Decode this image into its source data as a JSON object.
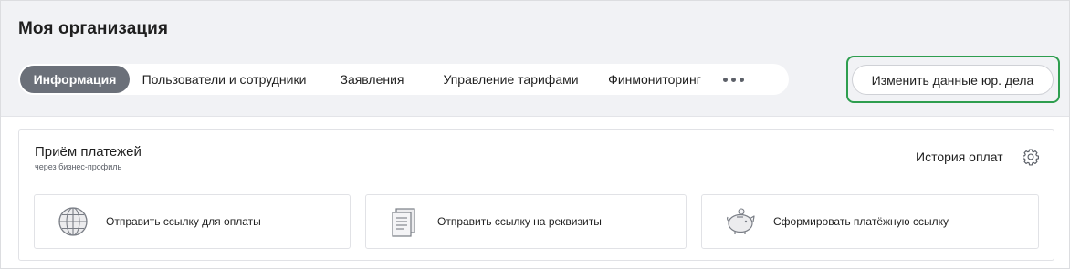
{
  "header": {
    "title": "Моя организация"
  },
  "tabs": [
    {
      "label": "Информация",
      "active": true
    },
    {
      "label": "Пользователи и сотрудники",
      "active": false
    },
    {
      "label": "Заявления",
      "active": false
    },
    {
      "label": "Управление тарифами",
      "active": false
    },
    {
      "label": "Финмониторинг",
      "active": false
    }
  ],
  "tabs_more_icon": "more-dots-icon",
  "edit_button": {
    "label": "Изменить данные юр. дела"
  },
  "payments": {
    "title": "Приём платежей",
    "subtitle": "через бизнес-профиль",
    "history_label": "История оплат",
    "settings_icon": "gear-icon",
    "actions": [
      {
        "label": "Отправить ссылку для оплаты",
        "icon": "globe-icon"
      },
      {
        "label": "Отправить ссылку на реквизиты",
        "icon": "document-icon"
      },
      {
        "label": "Сформировать платёжную ссылку",
        "icon": "piggy-bank-icon"
      }
    ]
  },
  "colors": {
    "header_bg": "#f1f2f5",
    "active_tab_bg": "#6b7079",
    "highlight_border": "#2e9e4f"
  }
}
